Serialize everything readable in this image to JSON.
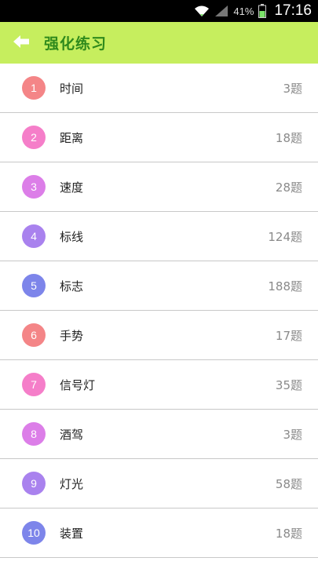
{
  "status_bar": {
    "battery_percent": "41%",
    "time": "17:16"
  },
  "header": {
    "title": "强化练习",
    "back_icon": "back-arrow-icon"
  },
  "colors": {
    "header_bg": "#c6ee5e",
    "title": "#2f8a1c"
  },
  "items": [
    {
      "number": "1",
      "label": "时间",
      "count": "3题",
      "color": "#f48587"
    },
    {
      "number": "2",
      "label": "距离",
      "count": "18题",
      "color": "#f57ec9"
    },
    {
      "number": "3",
      "label": "速度",
      "count": "28题",
      "color": "#dc7ee8"
    },
    {
      "number": "4",
      "label": "标线",
      "count": "124题",
      "color": "#a982ee"
    },
    {
      "number": "5",
      "label": "标志",
      "count": "188题",
      "color": "#7d85ea"
    },
    {
      "number": "6",
      "label": "手势",
      "count": "17题",
      "color": "#f48587"
    },
    {
      "number": "7",
      "label": "信号灯",
      "count": "35题",
      "color": "#f57ec9"
    },
    {
      "number": "8",
      "label": "酒驾",
      "count": "3题",
      "color": "#dc7ee8"
    },
    {
      "number": "9",
      "label": "灯光",
      "count": "58题",
      "color": "#a982ee"
    },
    {
      "number": "10",
      "label": "装置",
      "count": "18题",
      "color": "#7d85ea"
    }
  ]
}
